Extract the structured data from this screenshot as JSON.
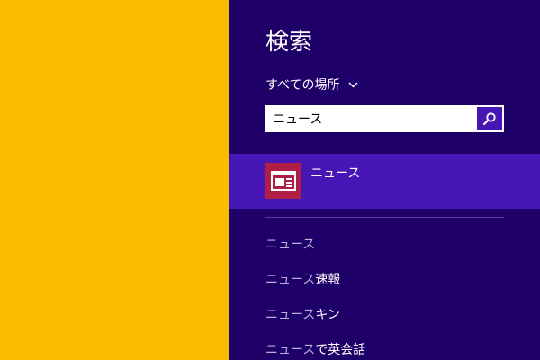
{
  "colors": {
    "desktop_background": "#fbbd00",
    "charm_background": "#1f0068",
    "accent": "#4617b4",
    "app_tile": "#b01e45",
    "suggestion_prefix": "#b9aedc"
  },
  "search_pane": {
    "title": "検索",
    "scope": {
      "label": "すべての場所",
      "icon": "chevron-down-icon"
    },
    "search_box": {
      "value": "ニュース",
      "button_icon": "magnifier-icon"
    }
  },
  "app_results": [
    {
      "label": "ニュース",
      "icon": "news-app-icon"
    }
  ],
  "suggestions": [
    {
      "prefix": "ニュース",
      "rest": ""
    },
    {
      "prefix": "ニュース",
      "rest": "速報"
    },
    {
      "prefix": "ニュース",
      "rest": "キン"
    },
    {
      "prefix": "ニュース",
      "rest": "で英会話"
    }
  ]
}
